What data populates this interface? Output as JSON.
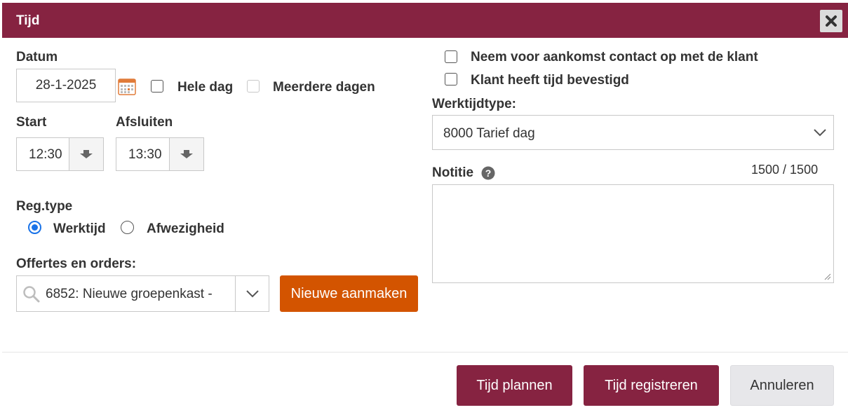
{
  "dialog": {
    "title": "Tijd"
  },
  "date": {
    "label": "Datum",
    "value": "28-1-2025",
    "all_day_label": "Hele dag",
    "multi_day_label": "Meerdere dagen"
  },
  "time": {
    "start_label": "Start",
    "start_value": "12:30",
    "end_label": "Afsluiten",
    "end_value": "13:30"
  },
  "reg_type": {
    "label": "Reg.type",
    "options": [
      "Werktijd",
      "Afwezigheid"
    ],
    "selected": "Werktijd"
  },
  "orders": {
    "label": "Offertes en orders:",
    "value": "6852: Nieuwe groepenkast -",
    "new_button": "Nieuwe aanmaken"
  },
  "right": {
    "contact_label": "Neem voor aankomst contact op met de klant",
    "confirmed_label": "Klant heeft tijd bevestigd",
    "worktype_label": "Werktijdtype:",
    "worktype_value": "8000 Tarief dag",
    "note_label": "Notitie",
    "note_counter": "1500 / 1500"
  },
  "footer": {
    "plan_button": "Tijd plannen",
    "register_button": "Tijd registreren",
    "cancel_button": "Annuleren"
  },
  "colors": {
    "brand": "#862341",
    "accent_orange": "#d35400",
    "radio_blue": "#1a73e8"
  }
}
